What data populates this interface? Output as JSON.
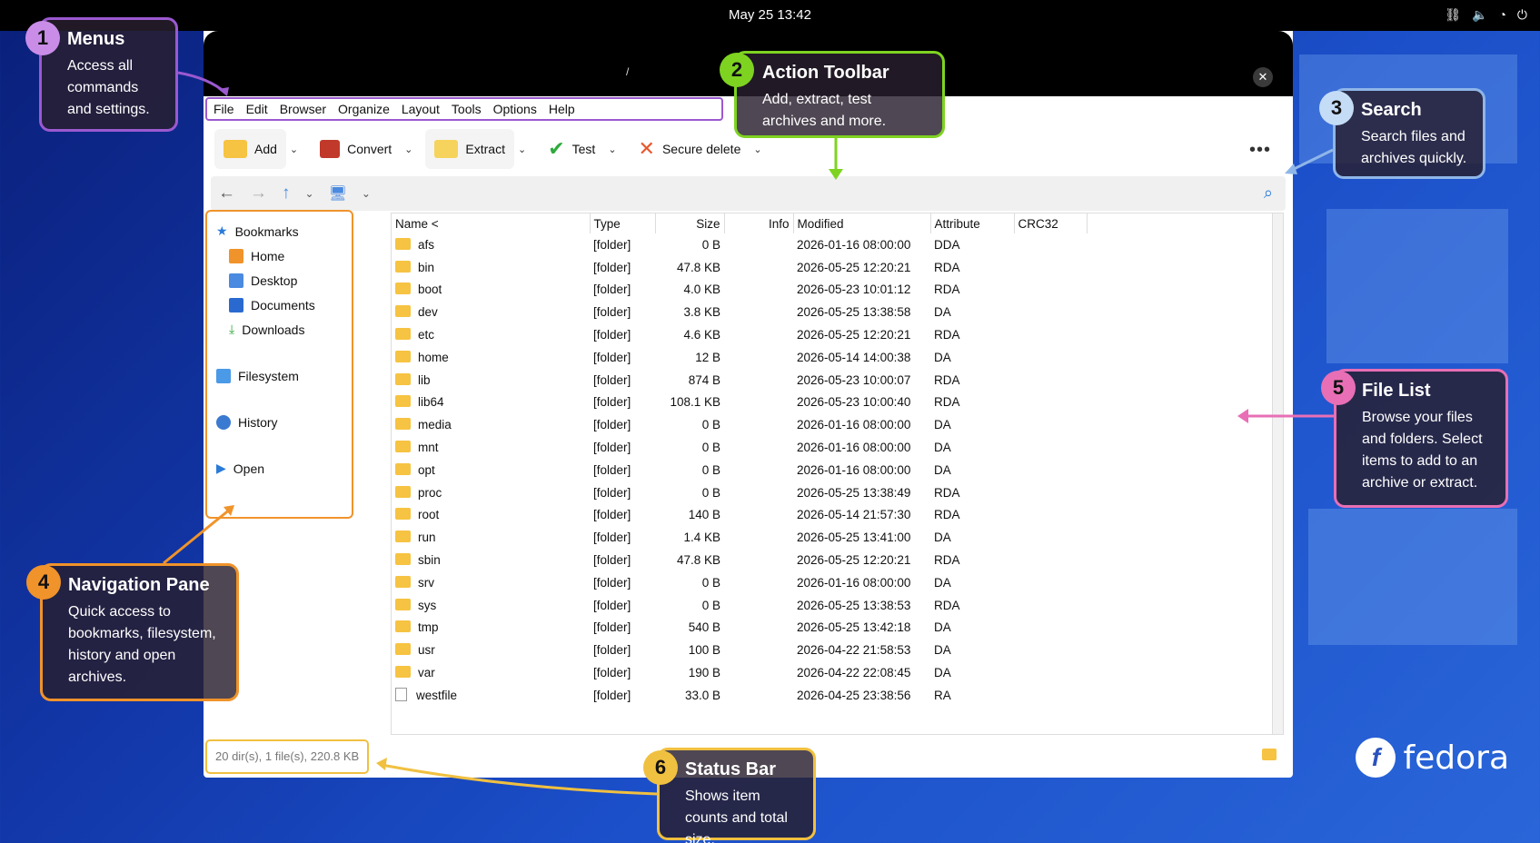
{
  "topbar": {
    "clock": "May 25  13:42"
  },
  "window": {
    "title": "/"
  },
  "menu": [
    "File",
    "Edit",
    "Browser",
    "Organize",
    "Layout",
    "Tools",
    "Options",
    "Help"
  ],
  "toolbar": {
    "add": "Add",
    "convert": "Convert",
    "extract": "Extract",
    "test": "Test",
    "secure_delete": "Secure delete"
  },
  "nav": {
    "bookmarks": "Bookmarks",
    "home": "Home",
    "desktop": "Desktop",
    "documents": "Documents",
    "downloads": "Downloads",
    "filesystem": "Filesystem",
    "history": "History",
    "open": "Open"
  },
  "columns": {
    "name": "Name <",
    "type": "Type",
    "size": "Size",
    "info": "Info",
    "modified": "Modified",
    "attribute": "Attribute",
    "crc": "CRC32"
  },
  "rows": [
    {
      "name": "afs",
      "type": "[folder]",
      "size": "0 B",
      "modified": "2026-01-16 08:00:00",
      "attr": "DDA"
    },
    {
      "name": "bin",
      "type": "[folder]",
      "size": "47.8 KB",
      "modified": "2026-05-25 12:20:21",
      "attr": "RDA"
    },
    {
      "name": "boot",
      "type": "[folder]",
      "size": "4.0 KB",
      "modified": "2026-05-23 10:01:12",
      "attr": "RDA"
    },
    {
      "name": "dev",
      "type": "[folder]",
      "size": "3.8 KB",
      "modified": "2026-05-25 13:38:58",
      "attr": "DA"
    },
    {
      "name": "etc",
      "type": "[folder]",
      "size": "4.6 KB",
      "modified": "2026-05-25 12:20:21",
      "attr": "RDA"
    },
    {
      "name": "home",
      "type": "[folder]",
      "size": "12 B",
      "modified": "2026-05-14 14:00:38",
      "attr": "DA"
    },
    {
      "name": "lib",
      "type": "[folder]",
      "size": "874 B",
      "modified": "2026-05-23 10:00:07",
      "attr": "RDA"
    },
    {
      "name": "lib64",
      "type": "[folder]",
      "size": "108.1 KB",
      "modified": "2026-05-23 10:00:40",
      "attr": "RDA"
    },
    {
      "name": "media",
      "type": "[folder]",
      "size": "0 B",
      "modified": "2026-01-16 08:00:00",
      "attr": "DA"
    },
    {
      "name": "mnt",
      "type": "[folder]",
      "size": "0 B",
      "modified": "2026-01-16 08:00:00",
      "attr": "DA"
    },
    {
      "name": "opt",
      "type": "[folder]",
      "size": "0 B",
      "modified": "2026-01-16 08:00:00",
      "attr": "DA"
    },
    {
      "name": "proc",
      "type": "[folder]",
      "size": "0 B",
      "modified": "2026-05-25 13:38:49",
      "attr": "RDA"
    },
    {
      "name": "root",
      "type": "[folder]",
      "size": "140 B",
      "modified": "2026-05-14 21:57:30",
      "attr": "RDA"
    },
    {
      "name": "run",
      "type": "[folder]",
      "size": "1.4 KB",
      "modified": "2026-05-25 13:41:00",
      "attr": "DA"
    },
    {
      "name": "sbin",
      "type": "[folder]",
      "size": "47.8 KB",
      "modified": "2026-05-25 12:20:21",
      "attr": "RDA"
    },
    {
      "name": "srv",
      "type": "[folder]",
      "size": "0 B",
      "modified": "2026-01-16 08:00:00",
      "attr": "DA"
    },
    {
      "name": "sys",
      "type": "[folder]",
      "size": "0 B",
      "modified": "2026-05-25 13:38:53",
      "attr": "RDA"
    },
    {
      "name": "tmp",
      "type": "[folder]",
      "size": "540 B",
      "modified": "2026-05-25 13:42:18",
      "attr": "DA"
    },
    {
      "name": "usr",
      "type": "[folder]",
      "size": "100 B",
      "modified": "2026-04-22 21:58:53",
      "attr": "DA"
    },
    {
      "name": "var",
      "type": "[folder]",
      "size": "190 B",
      "modified": "2026-04-22 22:08:45",
      "attr": "DA"
    },
    {
      "name": "westfile",
      "type": "[folder]",
      "size": "33.0 B",
      "modified": "2026-04-25 23:38:56",
      "attr": "RA",
      "file": true
    }
  ],
  "status": {
    "text": "20 dir(s), 1 file(s), 220.8 KB"
  },
  "callouts": [
    {
      "num": "1",
      "title": "Menus",
      "desc": "Access all commands and settings."
    },
    {
      "num": "2",
      "title": "Action Toolbar",
      "desc": "Add, extract, test archives and more."
    },
    {
      "num": "3",
      "title": "Search",
      "desc": "Search files and archives quickly."
    },
    {
      "num": "4",
      "title": "Navigation Pane",
      "desc": "Quick access to bookmarks, filesystem, history and open archives."
    },
    {
      "num": "5",
      "title": "File List",
      "desc": "Browse your files and folders. Select items to add to an archive or extract."
    },
    {
      "num": "6",
      "title": "Status Bar",
      "desc": "Shows item counts and total size."
    }
  ],
  "brand": {
    "logo": "f",
    "name": "fedora"
  },
  "colors": {
    "menus": "#9b59d0",
    "toolbar": "#7ed321",
    "search": "#8fb6e8",
    "nav": "#f0932b",
    "filelist": "#e86fb5",
    "status": "#f0c040"
  }
}
